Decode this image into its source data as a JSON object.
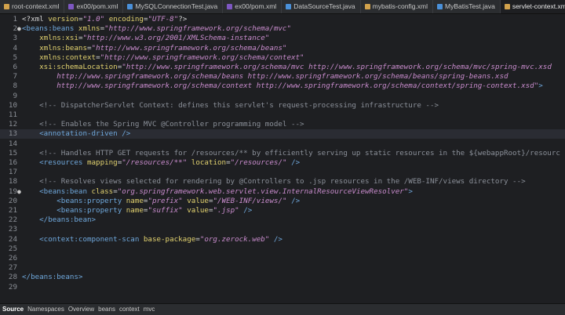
{
  "tabs": [
    {
      "label": "root-context.xml",
      "icon": "xml-file-icon",
      "color": "#d2a24c",
      "active": false
    },
    {
      "label": "ex00/pom.xml",
      "icon": "maven-file-icon",
      "color": "#7e57c2",
      "active": false
    },
    {
      "label": "MySQLConnectionTest.java",
      "icon": "java-file-icon",
      "color": "#4a90d9",
      "active": false
    },
    {
      "label": "ex00/pom.xml",
      "icon": "maven-file-icon",
      "color": "#7e57c2",
      "active": false
    },
    {
      "label": "DataSourceTest.java",
      "icon": "java-file-icon",
      "color": "#4a90d9",
      "active": false
    },
    {
      "label": "mybatis-config.xml",
      "icon": "xml-file-icon",
      "color": "#d2a24c",
      "active": false
    },
    {
      "label": "MyBatisTest.java",
      "icon": "java-file-icon",
      "color": "#4a90d9",
      "active": false
    },
    {
      "label": "servlet-context.xml",
      "icon": "xml-file-icon",
      "color": "#d2a24c",
      "active": true,
      "close": "✕"
    }
  ],
  "lines": [
    {
      "n": "1",
      "fold": "",
      "segs": [
        [
          "pi",
          "<?xml "
        ],
        [
          "attr",
          "version"
        ],
        [
          "pi",
          "="
        ],
        [
          "str",
          "\"1.0\""
        ],
        [
          "pi",
          " "
        ],
        [
          "attr",
          "encoding"
        ],
        [
          "pi",
          "="
        ],
        [
          "str",
          "\"UTF-8\""
        ],
        [
          "pi",
          "?>"
        ]
      ]
    },
    {
      "n": "2",
      "fold": "●",
      "segs": [
        [
          "tag",
          "<beans:beans "
        ],
        [
          "attr",
          "xmlns"
        ],
        [
          "pi",
          "="
        ],
        [
          "str",
          "\"http://www.springframework.org/schema/mvc\""
        ]
      ]
    },
    {
      "n": "3",
      "fold": "",
      "segs": [
        [
          "pi",
          "    "
        ],
        [
          "attr",
          "xmlns:xsi"
        ],
        [
          "pi",
          "="
        ],
        [
          "str",
          "\"http://www.w3.org/2001/XMLSchema-instance\""
        ]
      ]
    },
    {
      "n": "4",
      "fold": "",
      "segs": [
        [
          "pi",
          "    "
        ],
        [
          "attr",
          "xmlns:beans"
        ],
        [
          "pi",
          "="
        ],
        [
          "str",
          "\"http://www.springframework.org/schema/beans\""
        ]
      ]
    },
    {
      "n": "5",
      "fold": "",
      "segs": [
        [
          "pi",
          "    "
        ],
        [
          "attr",
          "xmlns:context"
        ],
        [
          "pi",
          "="
        ],
        [
          "str",
          "\"http://www.springframework.org/schema/context\""
        ]
      ]
    },
    {
      "n": "6",
      "fold": "",
      "segs": [
        [
          "pi",
          "    "
        ],
        [
          "attr",
          "xsi:schemaLocation"
        ],
        [
          "pi",
          "="
        ],
        [
          "str",
          "\"http://www.springframework.org/schema/mvc http://www.springframework.org/schema/mvc/spring-mvc.xsd"
        ]
      ]
    },
    {
      "n": "7",
      "fold": "",
      "segs": [
        [
          "str",
          "        http://www.springframework.org/schema/beans http://www.springframework.org/schema/beans/spring-beans.xsd"
        ]
      ]
    },
    {
      "n": "8",
      "fold": "",
      "segs": [
        [
          "str",
          "        http://www.springframework.org/schema/context http://www.springframework.org/schema/context/spring-context.xsd\""
        ],
        [
          "tag",
          ">"
        ]
      ]
    },
    {
      "n": "9",
      "fold": "",
      "segs": []
    },
    {
      "n": "10",
      "fold": "",
      "segs": [
        [
          "com",
          "    <!-- DispatcherServlet Context: defines this servlet's request-processing infrastructure -->"
        ]
      ]
    },
    {
      "n": "11",
      "fold": "",
      "segs": []
    },
    {
      "n": "12",
      "fold": "",
      "segs": [
        [
          "com",
          "    <!-- Enables the Spring MVC @Controller programming model -->"
        ]
      ]
    },
    {
      "n": "13",
      "fold": "",
      "hl": true,
      "segs": [
        [
          "tag",
          "    <annotation-driven />"
        ]
      ]
    },
    {
      "n": "14",
      "fold": "",
      "segs": []
    },
    {
      "n": "15",
      "fold": "",
      "segs": [
        [
          "com",
          "    <!-- Handles HTTP GET requests for /resources/** by efficiently serving up static resources in the ${webappRoot}/resourc"
        ]
      ]
    },
    {
      "n": "16",
      "fold": "",
      "segs": [
        [
          "tag",
          "    <resources "
        ],
        [
          "attr",
          "mapping"
        ],
        [
          "pi",
          "="
        ],
        [
          "str",
          "\"/resources/**\""
        ],
        [
          "pi",
          " "
        ],
        [
          "attr",
          "location"
        ],
        [
          "pi",
          "="
        ],
        [
          "str",
          "\"/resources/\""
        ],
        [
          "tag",
          " />"
        ]
      ]
    },
    {
      "n": "17",
      "fold": "",
      "segs": []
    },
    {
      "n": "18",
      "fold": "",
      "segs": [
        [
          "com",
          "    <!-- Resolves views selected for rendering by @Controllers to .jsp resources in the /WEB-INF/views directory -->"
        ]
      ]
    },
    {
      "n": "19",
      "fold": "●",
      "segs": [
        [
          "tag",
          "    <beans:bean "
        ],
        [
          "attr",
          "class"
        ],
        [
          "pi",
          "="
        ],
        [
          "str",
          "\"org.springframework.web.servlet.view.InternalResourceViewResolver\""
        ],
        [
          "tag",
          ">"
        ]
      ]
    },
    {
      "n": "20",
      "fold": "",
      "segs": [
        [
          "tag",
          "        <beans:property "
        ],
        [
          "attr",
          "name"
        ],
        [
          "pi",
          "="
        ],
        [
          "str",
          "\"prefix\""
        ],
        [
          "pi",
          " "
        ],
        [
          "attr",
          "value"
        ],
        [
          "pi",
          "="
        ],
        [
          "str",
          "\"/WEB-INF/views/\""
        ],
        [
          "tag",
          " />"
        ]
      ]
    },
    {
      "n": "21",
      "fold": "",
      "segs": [
        [
          "tag",
          "        <beans:property "
        ],
        [
          "attr",
          "name"
        ],
        [
          "pi",
          "="
        ],
        [
          "str",
          "\"suffix\""
        ],
        [
          "pi",
          " "
        ],
        [
          "attr",
          "value"
        ],
        [
          "pi",
          "="
        ],
        [
          "str",
          "\".jsp\""
        ],
        [
          "tag",
          " />"
        ]
      ]
    },
    {
      "n": "22",
      "fold": "",
      "segs": [
        [
          "tag",
          "    </beans:bean>"
        ]
      ]
    },
    {
      "n": "23",
      "fold": "",
      "segs": []
    },
    {
      "n": "24",
      "fold": "",
      "segs": [
        [
          "tag",
          "    <context:component-scan "
        ],
        [
          "attr",
          "base-package"
        ],
        [
          "pi",
          "="
        ],
        [
          "str",
          "\"org.zerock.web\""
        ],
        [
          "tag",
          " />"
        ]
      ]
    },
    {
      "n": "25",
      "fold": "",
      "segs": []
    },
    {
      "n": "26",
      "fold": "",
      "segs": []
    },
    {
      "n": "27",
      "fold": "",
      "segs": []
    },
    {
      "n": "28",
      "fold": "",
      "segs": [
        [
          "tag",
          "</beans:beans>"
        ]
      ]
    },
    {
      "n": "29",
      "fold": "",
      "segs": []
    }
  ],
  "bottom_tabs": [
    {
      "label": "Source",
      "active": true
    },
    {
      "label": "Namespaces",
      "active": false
    },
    {
      "label": "Overview",
      "active": false
    },
    {
      "label": "beans",
      "active": false
    },
    {
      "label": "context",
      "active": false
    },
    {
      "label": "mvc",
      "active": false
    }
  ]
}
